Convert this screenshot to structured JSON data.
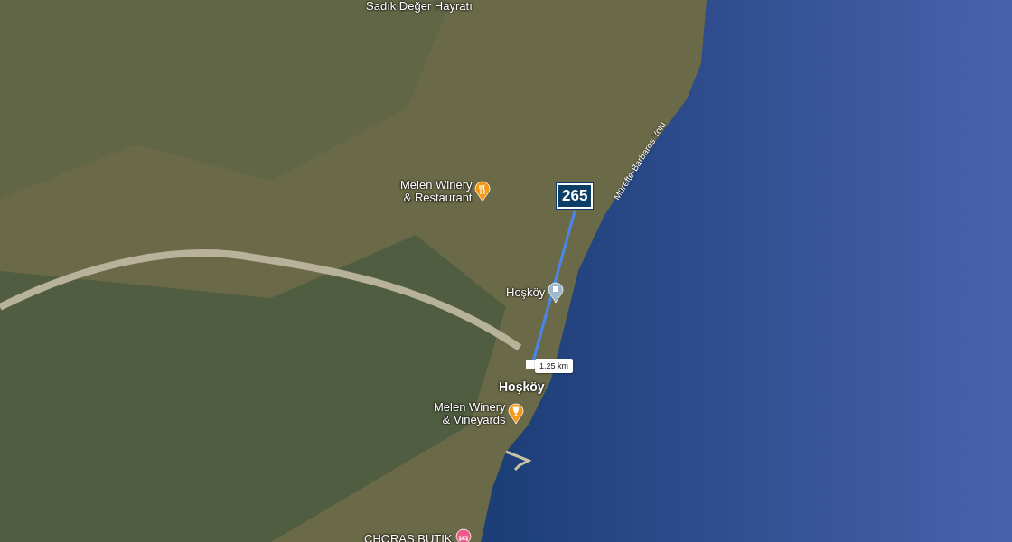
{
  "map": {
    "labels": [
      {
        "kind": "place",
        "text": "Sadık Değer Hayratı"
      },
      {
        "kind": "restaurant",
        "text": "Melen Winery\n& Restaurant"
      },
      {
        "kind": "road",
        "text": "Mürefte-Barbaros Yolu"
      },
      {
        "kind": "landmark",
        "text": "Hoşköy"
      },
      {
        "kind": "town",
        "text": "Hoşköy"
      },
      {
        "kind": "winery",
        "text": "Melen Winery\n& Vineyards"
      },
      {
        "kind": "hotel",
        "text": "CHORAS BUTIK"
      }
    ],
    "highway_shield": {
      "text": "265"
    },
    "measurement": {
      "distance": "1,25 km"
    }
  }
}
